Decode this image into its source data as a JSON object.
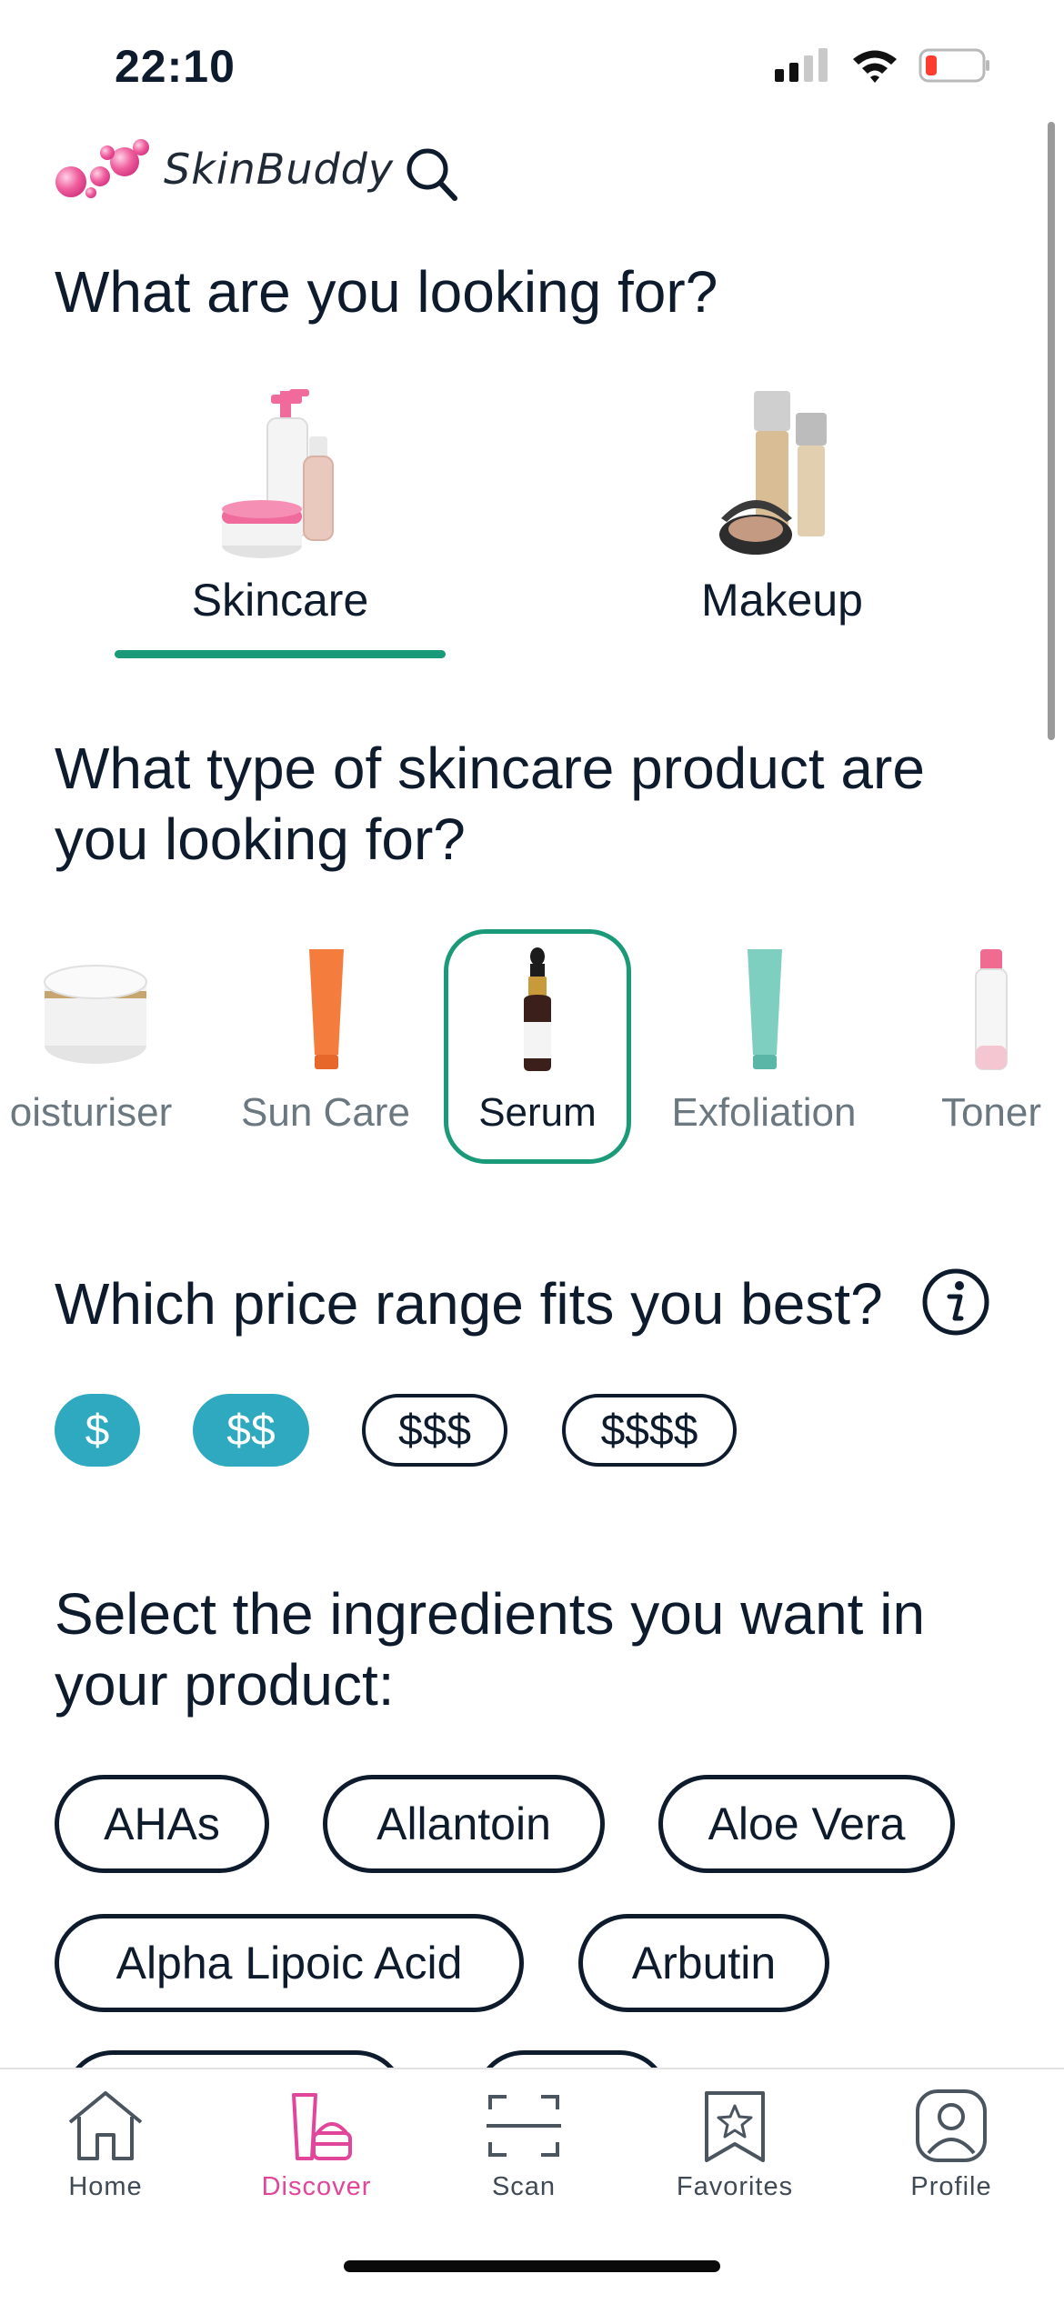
{
  "status_bar": {
    "time": "22:10"
  },
  "header": {
    "app_name": "SkinBuddy"
  },
  "category_section": {
    "question": "What are you looking for?",
    "categories": [
      {
        "label": "Skincare",
        "selected": true
      },
      {
        "label": "Makeup",
        "selected": false
      }
    ]
  },
  "product_type_section": {
    "question": "What type of skincare product are you looking for?",
    "types": [
      {
        "label": "oisturiser",
        "selected": false
      },
      {
        "label": "Sun Care",
        "selected": false
      },
      {
        "label": "Serum",
        "selected": true
      },
      {
        "label": "Exfoliation",
        "selected": false
      },
      {
        "label": "Toner",
        "selected": false
      }
    ]
  },
  "price_section": {
    "question": "Which price range fits you best?",
    "options": [
      {
        "label": "$",
        "selected": true
      },
      {
        "label": "$$",
        "selected": true
      },
      {
        "label": "$$$",
        "selected": false
      },
      {
        "label": "$$$$",
        "selected": false
      }
    ]
  },
  "ingredients_section": {
    "question": "Select the ingredients you want in your product:",
    "chips": [
      "AHAs",
      "Allantoin",
      "Aloe Vera",
      "Alpha Lipoic Acid",
      "Arbutin"
    ]
  },
  "tab_bar": {
    "tabs": [
      {
        "label": "Home",
        "icon": "home-icon",
        "active": false
      },
      {
        "label": "Discover",
        "icon": "discover-icon",
        "active": true
      },
      {
        "label": "Scan",
        "icon": "scan-icon",
        "active": false
      },
      {
        "label": "Favorites",
        "icon": "favorites-icon",
        "active": false
      },
      {
        "label": "Profile",
        "icon": "profile-icon",
        "active": false
      }
    ]
  },
  "colors": {
    "accent_green": "#1a9a78",
    "price_active": "#2ea9bf",
    "brand_pink": "#e2469a",
    "text_dark": "#0e1b2c"
  }
}
